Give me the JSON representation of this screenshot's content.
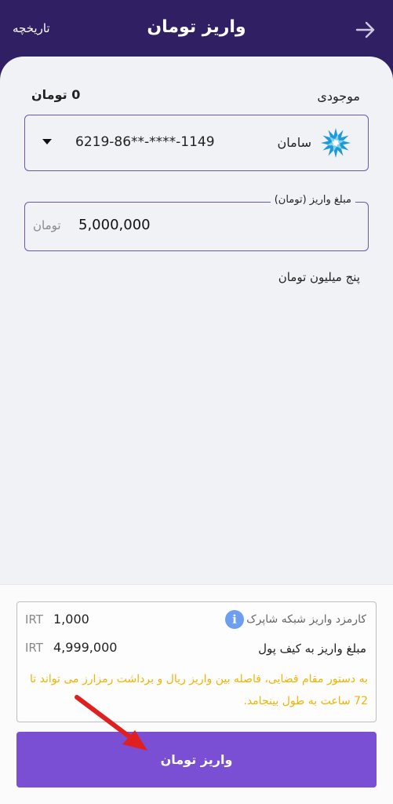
{
  "header": {
    "title": "واریز تومان",
    "history_label": "تاریخچه",
    "back_icon": "arrow-right-icon"
  },
  "balance": {
    "label": "موجودی",
    "value": "0 تومان"
  },
  "bank_selector": {
    "bank_name": "سامان",
    "card_number": "6219-86**-****-1149",
    "logo_icon": "saman-bank-logo-icon",
    "dropdown_icon": "caret-down-icon"
  },
  "amount_field": {
    "legend": "مبلغ واریز (تومان)",
    "value": "5,000,000",
    "unit": "تومان"
  },
  "amount_in_words": "پنج میلیون تومان",
  "summary": {
    "fee_label": "کارمزد واریز شبکه شاپرک",
    "fee_amount": "1,000",
    "fee_currency": "IRT",
    "info_icon_glyph": "i",
    "wallet_label": "مبلغ واریز به کیف پول",
    "wallet_amount": "4,999,000",
    "wallet_currency": "IRT",
    "warning": "به دستور مقام قضایی، فاصله بین واریز ریال و برداشت رمزارز می تواند تا 72 ساعت به طول بینجامد."
  },
  "submit_label": "واریز تومان",
  "colors": {
    "header_bg": "#311f63",
    "accent": "#7a4fd4",
    "warning": "#f0b400",
    "annotation_arrow": "#e02020"
  }
}
